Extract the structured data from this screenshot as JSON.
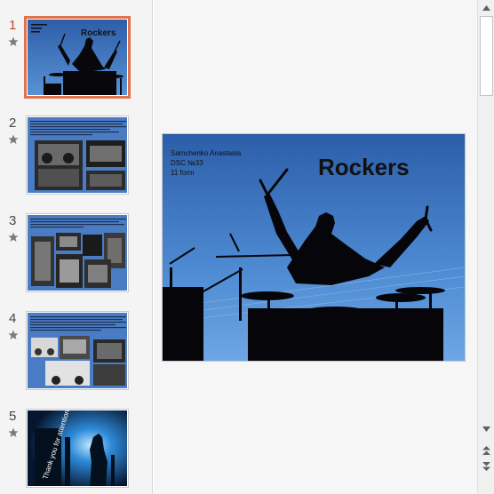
{
  "thumbnails": [
    {
      "number": "1",
      "title": "Rockers",
      "active": true
    },
    {
      "number": "2",
      "active": false
    },
    {
      "number": "3",
      "active": false
    },
    {
      "number": "4",
      "active": false
    },
    {
      "number": "5",
      "caption": "Thank you for attention",
      "active": false
    }
  ],
  "main_slide": {
    "author_lines": [
      "Samchenko Anastasia",
      "DSC №33",
      "11 form"
    ],
    "title": "Rockers"
  },
  "icons": {
    "animation_star": "star-icon",
    "scroll_up": "arrow-up-icon",
    "scroll_down": "arrow-down-icon",
    "prev_slide": "double-chevron-up-icon",
    "next_slide": "double-chevron-down-icon"
  },
  "colors": {
    "active_border": "#e2724b",
    "active_number": "#c8442a",
    "slide_blue": "#3f72b8"
  }
}
